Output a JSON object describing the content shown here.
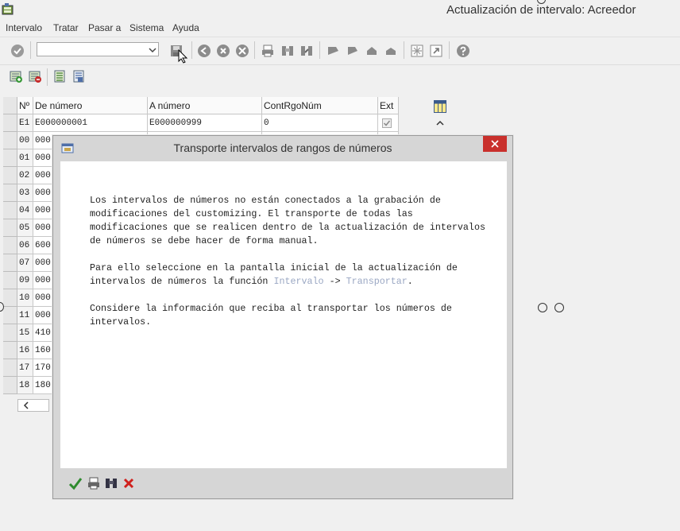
{
  "window": {
    "title": "Actualización de intervalo: Acreedor"
  },
  "menu": {
    "items": [
      "Intervalo",
      "Tratar",
      "Pasar a",
      "Sistema",
      "Ayuda"
    ]
  },
  "command_field": {
    "value": ""
  },
  "table": {
    "headers": [
      "Nº",
      "De número",
      "A número",
      "ContRgoNúm",
      "Ext"
    ],
    "rows": [
      {
        "no": "E1",
        "from": "E000000001",
        "to": "E000000999",
        "count": "0",
        "ext": true
      },
      {
        "no": "00",
        "from": "000"
      },
      {
        "no": "01",
        "from": "000"
      },
      {
        "no": "02",
        "from": "000"
      },
      {
        "no": "03",
        "from": "000"
      },
      {
        "no": "04",
        "from": "000"
      },
      {
        "no": "05",
        "from": "000"
      },
      {
        "no": "06",
        "from": "600"
      },
      {
        "no": "07",
        "from": "000"
      },
      {
        "no": "09",
        "from": "000"
      },
      {
        "no": "10",
        "from": "000"
      },
      {
        "no": "11",
        "from": "000"
      },
      {
        "no": "15",
        "from": "410"
      },
      {
        "no": "16",
        "from": "160"
      },
      {
        "no": "17",
        "from": "170"
      },
      {
        "no": "18",
        "from": "180"
      }
    ]
  },
  "dialog": {
    "title": "Transporte intervalos de rangos de números",
    "para1": "Los intervalos de números no están conectados a la grabación de\nmodificaciones del customizing. El transporte de todas las\nmodificaciones que se realicen dentro de la actualización de intervalos\nde números se debe hacer de forma manual.",
    "para2_line1": "Para ello seleccione en la pantalla inicial de la actualización de",
    "para2_line2_prefix": "intervalos de números la función ",
    "para2_link1": "Intervalo",
    "para2_arrow": " -> ",
    "para2_link2": "Transportar",
    "para2_suffix": ".",
    "para3": "Considere la información que reciba al transportar los números de\nintervalos.",
    "colors": {
      "link": "#9aa7c3",
      "close": "#c9302c",
      "confirm": "#2e8b2e",
      "cancel": "#d0201c"
    }
  }
}
